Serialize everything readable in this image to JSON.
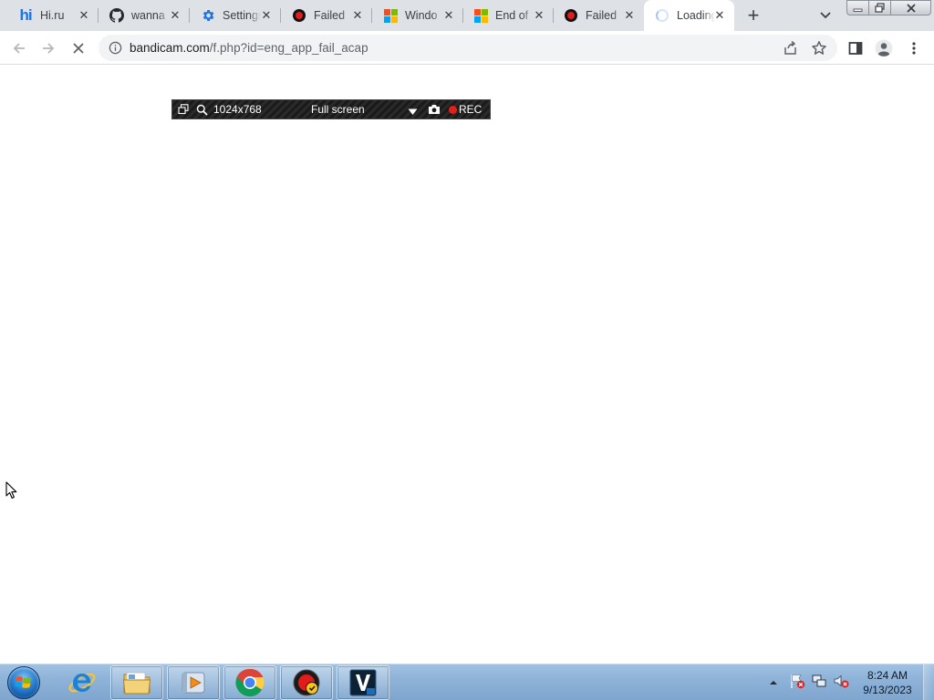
{
  "window_controls": {
    "minimize_icon": "minimize-icon",
    "restore_icon": "restore-icon",
    "close_icon": "close-icon"
  },
  "tabs": [
    {
      "title": "Hi.ru",
      "icon": "hi-logo-icon",
      "active": false
    },
    {
      "title": "wanna",
      "icon": "github-icon",
      "active": false
    },
    {
      "title": "Settings",
      "icon": "gear-icon",
      "active": false
    },
    {
      "title": "Failed",
      "icon": "bandicam-icon",
      "active": false
    },
    {
      "title": "Windo",
      "icon": "microsoft-icon",
      "active": false
    },
    {
      "title": "End of",
      "icon": "microsoft-icon",
      "active": false
    },
    {
      "title": "Failed",
      "icon": "bandicam-icon",
      "active": false
    },
    {
      "title": "Loading",
      "icon": "loading-spinner-icon",
      "active": true
    }
  ],
  "toolbar": {
    "url_host": "bandicam.com",
    "url_path": "/f.php?id=eng_app_fail_acap"
  },
  "bandicam_bar": {
    "resolution": "1024x768",
    "mode": "Full screen",
    "rec_label": "REC"
  },
  "taskbar": {
    "apps": [
      {
        "name": "internet-explorer",
        "open": false
      },
      {
        "name": "file-explorer",
        "open": true
      },
      {
        "name": "media-player",
        "open": true
      },
      {
        "name": "chrome",
        "open": true
      },
      {
        "name": "bandicam",
        "open": true
      },
      {
        "name": "vegas-pro",
        "open": true
      }
    ],
    "clock_time": "8:24 AM",
    "clock_date": "9/13/2023"
  },
  "colors": {
    "tabstrip_bg": "#dee1e6",
    "omnibox_bg": "#f1f3f4",
    "taskbar_bg": "#8fb3d8",
    "rec_red": "#e3211b"
  }
}
